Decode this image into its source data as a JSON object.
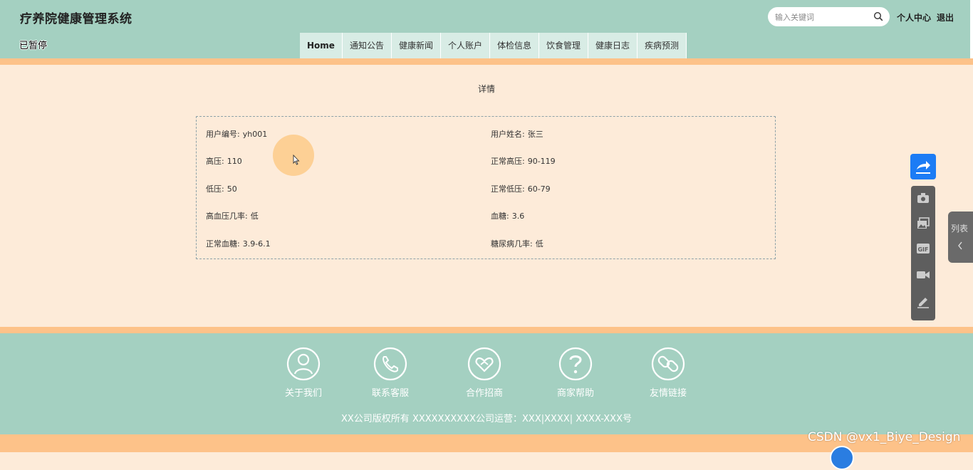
{
  "header": {
    "site_title": "疗养院健康管理系统",
    "paused_label": "已暂停",
    "search_placeholder": "输入关键词",
    "user_center": "个人中心",
    "logout": "退出"
  },
  "nav": {
    "tabs": [
      {
        "label": "Home",
        "active": true
      },
      {
        "label": "通知公告"
      },
      {
        "label": "健康新闻"
      },
      {
        "label": "个人账户"
      },
      {
        "label": "体检信息"
      },
      {
        "label": "饮食管理"
      },
      {
        "label": "健康日志"
      },
      {
        "label": "疾病预测"
      }
    ]
  },
  "detail": {
    "title": "详情",
    "fields": [
      {
        "label": "用户编号:",
        "value": "yh001"
      },
      {
        "label": "用户姓名:",
        "value": "张三"
      },
      {
        "label": "高压:",
        "value": "110"
      },
      {
        "label": "正常高压:",
        "value": "90-119"
      },
      {
        "label": "低压:",
        "value": "50"
      },
      {
        "label": "正常低压:",
        "value": "60-79"
      },
      {
        "label": "高血压几率:",
        "value": "低"
      },
      {
        "label": "血糖:",
        "value": "3.6"
      },
      {
        "label": "正常血糖:",
        "value": "3.9-6.1"
      },
      {
        "label": "糖尿病几率:",
        "value": "低"
      }
    ]
  },
  "footer": {
    "items": [
      {
        "label": "关于我们",
        "icon": "person-icon"
      },
      {
        "label": "联系客服",
        "icon": "phone-icon"
      },
      {
        "label": "合作招商",
        "icon": "handshake-icon"
      },
      {
        "label": "商家帮助",
        "icon": "help-icon"
      },
      {
        "label": "友情链接",
        "icon": "link-icon"
      }
    ],
    "copyright": "XX公司版权所有 XXXXXXXXXX公司运营：XXX|XXXX| XXXX-XXX号"
  },
  "overlay": {
    "list_tab_label": "列表",
    "watermark": "CSDN @vx1_Biye_Design"
  },
  "colors": {
    "header_bg": "#a4d0c1",
    "accent_orange": "#fdc289",
    "content_bg": "#fdebd9",
    "share_blue": "#1c7cf5"
  }
}
